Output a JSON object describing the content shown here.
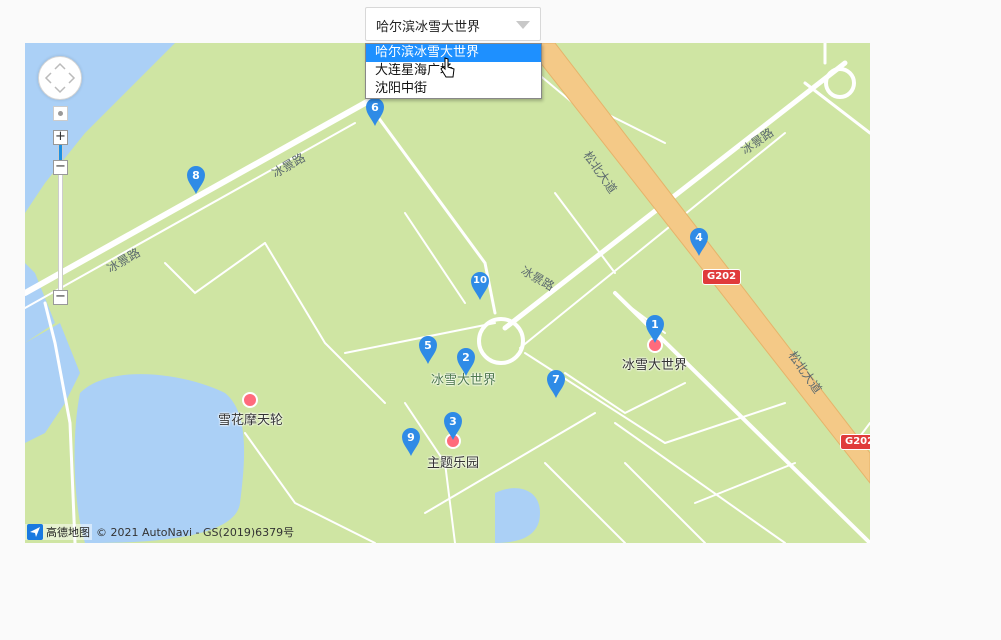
{
  "city_select": {
    "value": "哈尔滨冰雪大世界",
    "options": [
      "哈尔滨冰雪大世界",
      "大连星海广场",
      "沈阳中街"
    ]
  },
  "map": {
    "road_labels": [
      "冰景路",
      "冰景路",
      "冰景路",
      "冰景路",
      "松北大道",
      "松北大道"
    ],
    "shields": [
      "G202",
      "G202"
    ],
    "pois": [
      "冰雪大世界",
      "冰雪大世界",
      "雪花摩天轮",
      "主题乐园"
    ],
    "markers": [
      "1",
      "2",
      "3",
      "4",
      "5",
      "6",
      "7",
      "8",
      "9",
      "10"
    ],
    "marker_color": "#2f8be6",
    "water_color": "#abd0f6",
    "land_color": "#cfe5a3",
    "highway_color": "#f4c987"
  },
  "copyright": {
    "logo_text": "高德地图",
    "text": "© 2021 AutoNavi - GS(2019)6379号"
  }
}
